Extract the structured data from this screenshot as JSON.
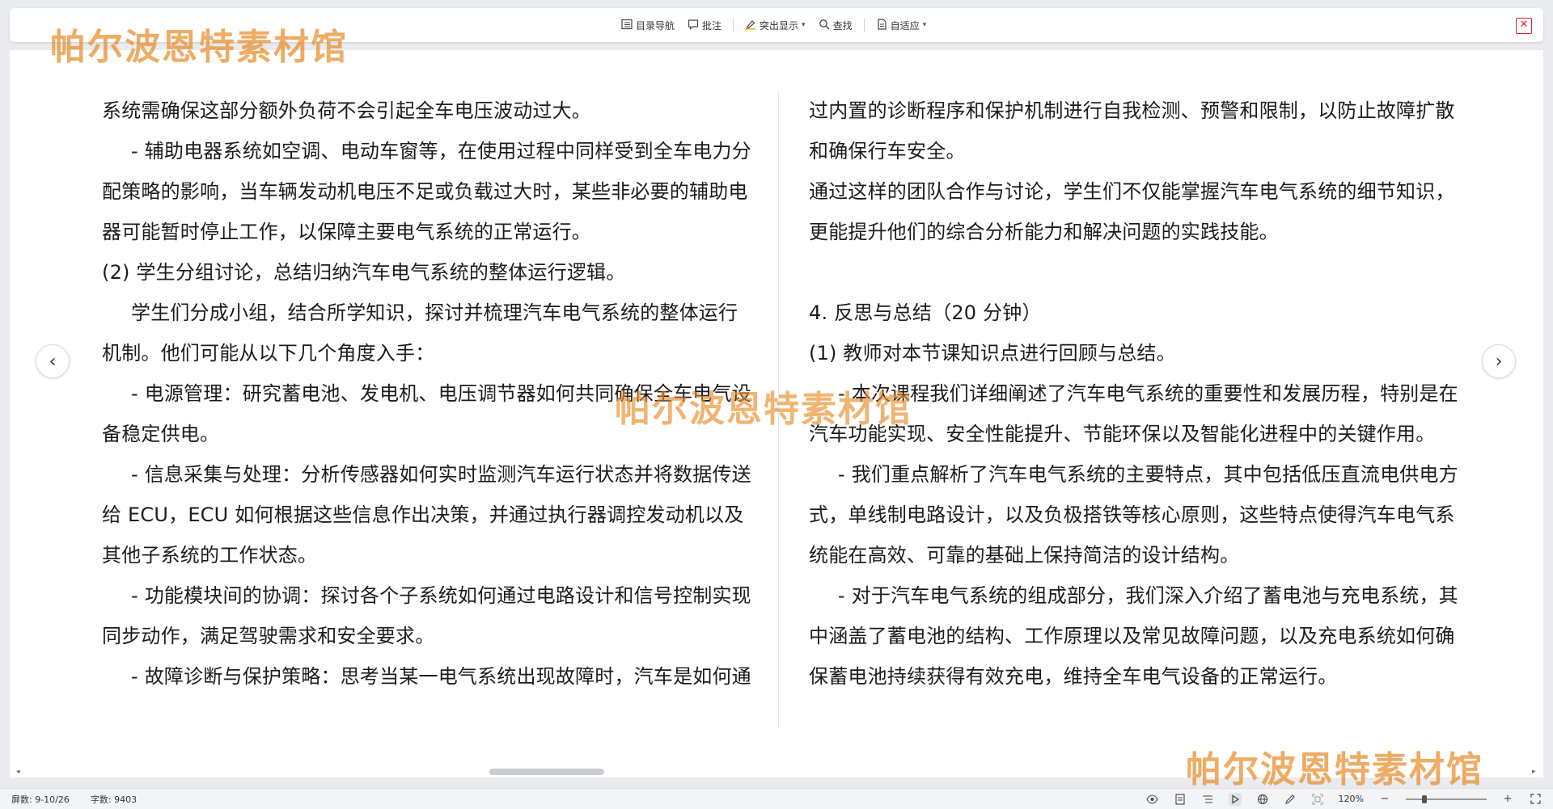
{
  "toolbar": {
    "toc_label": "目录导航",
    "comment_label": "批注",
    "highlight_label": "突出显示",
    "find_label": "查找",
    "fit_label": "自适应"
  },
  "document": {
    "left_paragraphs": [
      {
        "text": "系统需确保这部分额外负荷不会引起全车电压波动过大。",
        "indent": false
      },
      {
        "text": "- 辅助电器系统如空调、电动车窗等，在使用过程中同样受到全车电力分配策略的影响，当车辆发动机电压不足或负载过大时，某些非必要的辅助电器可能暂时停止工作，以保障主要电气系统的正常运行。",
        "indent": true
      },
      {
        "text": "(2) 学生分组讨论，总结归纳汽车电气系统的整体运行逻辑。",
        "indent": false
      },
      {
        "text": "学生们分成小组，结合所学知识，探讨并梳理汽车电气系统的整体运行机制。他们可能从以下几个角度入手：",
        "indent": true
      },
      {
        "text": "- 电源管理：研究蓄电池、发电机、电压调节器如何共同确保全车电气设备稳定供电。",
        "indent": true
      },
      {
        "text": "- 信息采集与处理：分析传感器如何实时监测汽车运行状态并将数据传送给 ECU，ECU 如何根据这些信息作出决策，并通过执行器调控发动机以及其他子系统的工作状态。",
        "indent": true
      },
      {
        "text": "- 功能模块间的协调：探讨各个子系统如何通过电路设计和信号控制实现同步动作，满足驾驶需求和安全要求。",
        "indent": true
      },
      {
        "text": "- 故障诊断与保护策略：思考当某一电气系统出现故障时，汽车是如何通",
        "indent": true
      }
    ],
    "right_paragraphs": [
      {
        "text": "过内置的诊断程序和保护机制进行自我检测、预警和限制，以防止故障扩散和确保行车安全。",
        "indent": false
      },
      {
        "text": "通过这样的团队合作与讨论，学生们不仅能掌握汽车电气系统的细节知识，更能提升他们的综合分析能力和解决问题的实践技能。",
        "indent": false
      },
      {
        "text": "",
        "indent": false
      },
      {
        "text": "4. 反思与总结（20 分钟）",
        "indent": false
      },
      {
        "text": "(1) 教师对本节课知识点进行回顾与总结。",
        "indent": false
      },
      {
        "text": "- 本次课程我们详细阐述了汽车电气系统的重要性和发展历程，特别是在汽车功能实现、安全性能提升、节能环保以及智能化进程中的关键作用。",
        "indent": true
      },
      {
        "text": "- 我们重点解析了汽车电气系统的主要特点，其中包括低压直流电供电方式，单线制电路设计，以及负极搭铁等核心原则，这些特点使得汽车电气系统能在高效、可靠的基础上保持简洁的设计结构。",
        "indent": true
      },
      {
        "text": "- 对于汽车电气系统的组成部分，我们深入介绍了蓄电池与充电系统，其中涵盖了蓄电池的结构、工作原理以及常见故障问题，以及充电系统如何确保蓄电池持续获得有效充电，维持全车电气设备的正常运行。",
        "indent": true
      }
    ]
  },
  "watermark": {
    "text": "帕尔波恩特素材馆"
  },
  "status": {
    "screen": "屏数: 9-10/26",
    "word_count": "字数: 9403",
    "zoom": "120%"
  },
  "colors": {
    "watermark": "#e88c28",
    "close": "#dd2233",
    "background": "#e9ebef"
  },
  "icons": {
    "prev_page": "chevron-left-icon",
    "next_page": "chevron-right-icon",
    "close": "close-icon"
  }
}
